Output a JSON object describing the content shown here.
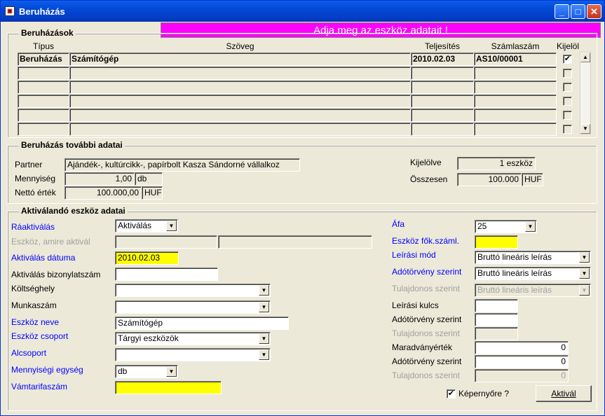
{
  "window": {
    "title": "Beruházás",
    "minimize": "_",
    "maximize": "□",
    "close": "✕"
  },
  "banner": "Adja meg az eszköz adatait !",
  "beruhazasok": {
    "legend": "Beruházások",
    "headers": {
      "tipus": "Típus",
      "szoveg": "Szöveg",
      "teljesites": "Teljesítés",
      "szamlaszam": "Számlaszám",
      "kijelol": "Kijelöl"
    },
    "row1": {
      "tipus": "Beruházás",
      "szoveg": "Számítógép",
      "teljesites": "2010.02.03",
      "szamlaszam": "AS10/00001",
      "check": "✔"
    }
  },
  "tovabbi": {
    "legend": "Beruházás további adatai",
    "partner_label": "Partner",
    "partner_value": "Ajándék-, kultúrcikk-, papírbolt  Kasza Sándorné vállalkoz",
    "mennyiseg_label": "Mennyiség",
    "mennyiseg_value": "1,00",
    "mennyiseg_unit": "db",
    "netto_label": "Nettó érték",
    "netto_value": "100.000,00",
    "netto_unit": "HUF",
    "kijelolve_label": "Kijelölve",
    "kijelolve_value": "1 eszköz",
    "osszesen_label": "Összesen",
    "osszesen_value": "100.000",
    "osszesen_unit": "HUF"
  },
  "aktivalando": {
    "legend": "Aktiválandó eszköz adatai",
    "raaktivalas_label": "Ráaktiválás",
    "raaktivalas_value": "Aktiválás",
    "eszkoz_amire_label": "Eszköz, amire aktivál",
    "aktivalas_datuma_label": "Aktiválás dátuma",
    "aktivalas_datuma_value": "2010.02.03",
    "bizonylatszam_label": "Aktiválás bizonylatszám",
    "koltseghely_label": "Költséghely",
    "munkaszam_label": "Munkaszám",
    "eszkoz_neve_label": "Eszköz neve",
    "eszkoz_neve_value": "Számítógép",
    "eszkoz_csoport_label": "Eszköz csoport",
    "eszkoz_csoport_value": "Tárgyi eszközök",
    "alcsoport_label": "Alcsoport",
    "mennyisegi_egyseg_label": "Mennyiségi egység",
    "mennyisegi_egyseg_value": "db",
    "vamtarifaszam_label": "Vámtarifaszám",
    "afa_label": "Áfa",
    "afa_value": "25",
    "fokszaml_label": "Eszköz fők.száml.",
    "leirasi_mod_label": "Leírási mód",
    "leirasi_mod_value": "Bruttó lineáris leírás",
    "adotorveny1_label": "Adótörvény szerint",
    "adotorveny1_value": "Bruttó lineáris leírás",
    "tulajdonos1_label": "Tulajdonos szerint",
    "tulajdonos1_value": "Bruttó lineáris leírás",
    "leirasi_kulcs_label": "Leírási kulcs",
    "adotorveny2_label": "Adótörvény szerint",
    "tulajdonos2_label": "Tulajdonos szerint",
    "maradvany_label": "Maradványérték",
    "maradvany_value": "0",
    "adotorveny3_label": "Adótörvény szerint",
    "adotorveny3_value": "0",
    "tulajdonos3_label": "Tulajdonos szerint",
    "tulajdonos3_value": "0",
    "kepernyore_label": "Képernyőre ?",
    "kepernyore_check": "✔",
    "aktival_button": "Aktivál"
  },
  "colors": {
    "banner": "#ff00ff",
    "required": "#0000ff",
    "highlight": "#ffff00"
  }
}
